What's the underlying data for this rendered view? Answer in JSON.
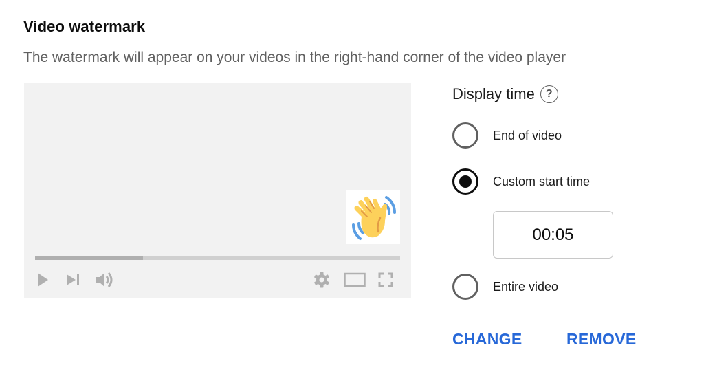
{
  "section": {
    "title": "Video watermark",
    "description": "The watermark will appear on your videos in the right-hand corner of the video player"
  },
  "preview": {
    "watermark_icon": "waving-hand-emoji",
    "progress_fraction": 0.295,
    "controls_left": [
      "play-icon",
      "next-icon",
      "volume-icon"
    ],
    "controls_right": [
      "settings-gear-icon",
      "theater-mode-icon",
      "fullscreen-icon"
    ],
    "colors": {
      "background": "#f2f2f2",
      "progress_track": "#d0d0d0",
      "progress_fill": "#afafaf",
      "control_icons": "#b0b0b0"
    }
  },
  "display_time": {
    "label": "Display time",
    "help_icon": "?",
    "options": [
      {
        "label": "End of video",
        "selected": false
      },
      {
        "label": "Custom start time",
        "selected": true
      },
      {
        "label": "Entire video",
        "selected": false
      }
    ],
    "custom_start_time_value": "00:05"
  },
  "actions": {
    "change_label": "CHANGE",
    "remove_label": "REMOVE",
    "accent_color": "#2768d8"
  }
}
